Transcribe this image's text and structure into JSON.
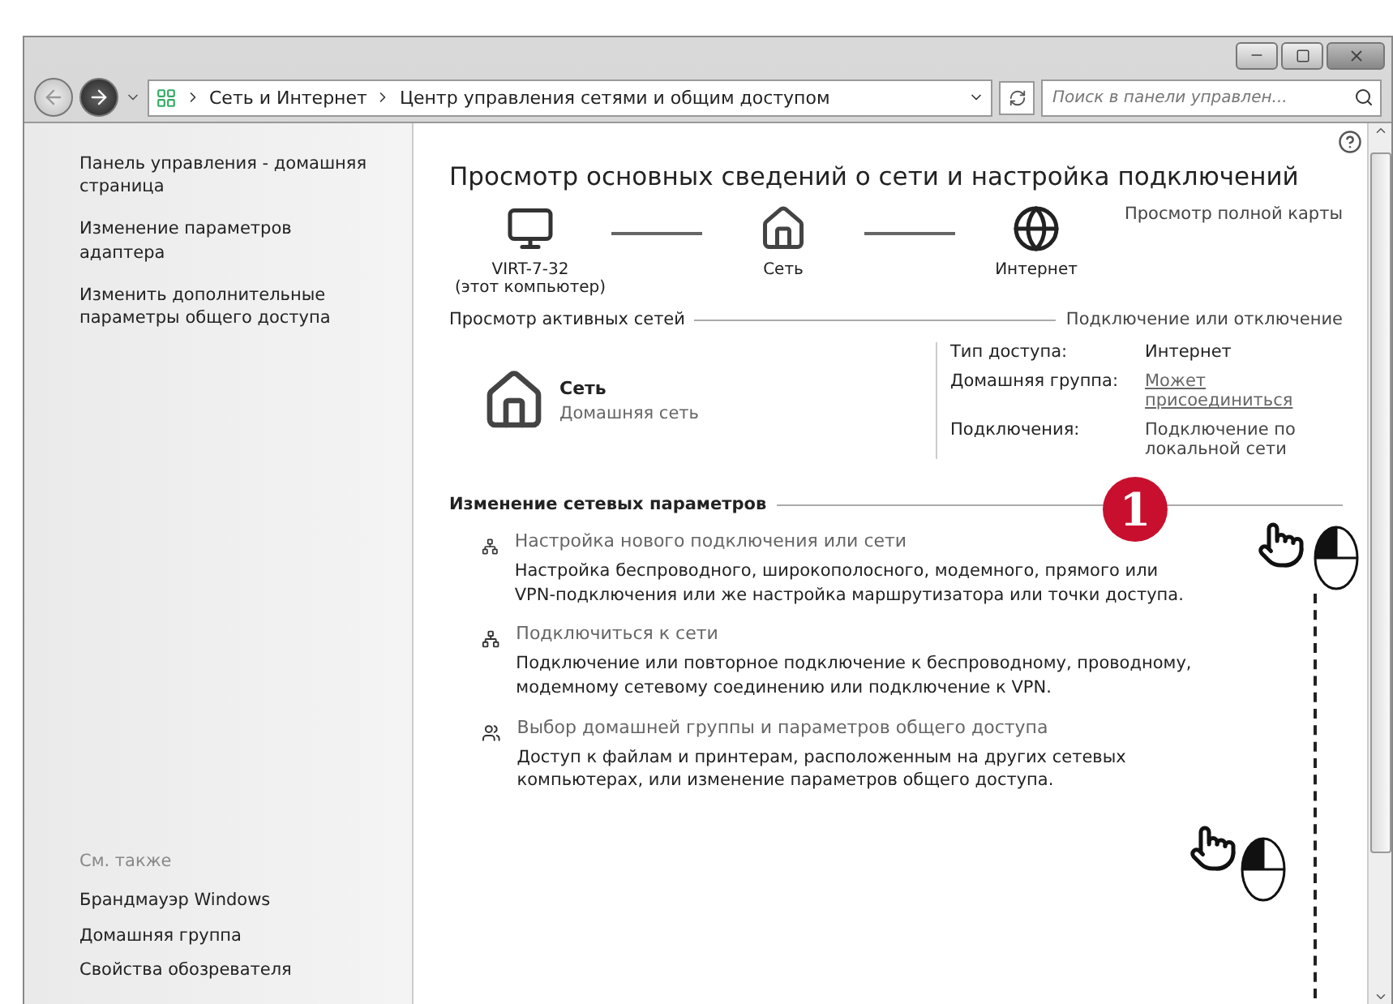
{
  "address_bar": {
    "path": [
      "Сеть и Интернет",
      "Центр управления сетями и общим доступом"
    ]
  },
  "search": {
    "placeholder": "Поиск в панели управлен..."
  },
  "sidebar": {
    "links": [
      "Панель управления - домашняя страница",
      "Изменение параметров адаптера",
      "Изменить дополнительные параметры общего доступа"
    ],
    "see_also": {
      "title": "См. также",
      "links": [
        "Брандмауэр Windows",
        "Домашняя группа",
        "Свойства обозревателя"
      ]
    }
  },
  "main": {
    "title": "Просмотр основных сведений о сети и настройка подключений",
    "map": {
      "full_map_link": "Просмотр полной карты",
      "nodes": [
        {
          "kind": "computer",
          "label": "VIRT-7-32",
          "sublabel": "(этот компьютер)"
        },
        {
          "kind": "house",
          "label": "Сеть"
        },
        {
          "kind": "globe",
          "label": "Интернет"
        }
      ]
    },
    "active_networks": {
      "title": "Просмотр активных сетей",
      "link": "Подключение или отключение",
      "network": {
        "name": "Сеть",
        "type": "Домашняя сеть"
      },
      "properties": [
        {
          "kind": "text",
          "label": "Тип доступа:",
          "value": "Интернет"
        },
        {
          "kind": "link",
          "label": "Домашняя группа:",
          "value": "Может присоединиться"
        },
        {
          "kind": "connection",
          "label": "Подключения:",
          "value": "Подключение по локальной сети"
        }
      ]
    },
    "change_settings": {
      "title": "Изменение сетевых параметров",
      "tasks": [
        {
          "kind": "network",
          "title": "Настройка нового подключения или сети",
          "description": "Настройка беспроводного, широкополосного, модемного, прямого или VPN-подключения или же настройка маршрутизатора или точки доступа."
        },
        {
          "kind": "network",
          "title": "Подключиться к сети",
          "description": "Подключение или повторное подключение к беспроводному, проводному, модемному сетевому соединению или подключение к VPN."
        },
        {
          "kind": "sharing",
          "title": "Выбор домашней группы и параметров общего доступа",
          "description": "Доступ к файлам и принтерам, расположенным на других сетевых компьютерах, или изменение параметров общего доступа."
        }
      ]
    }
  },
  "annotation": {
    "step": "1"
  }
}
